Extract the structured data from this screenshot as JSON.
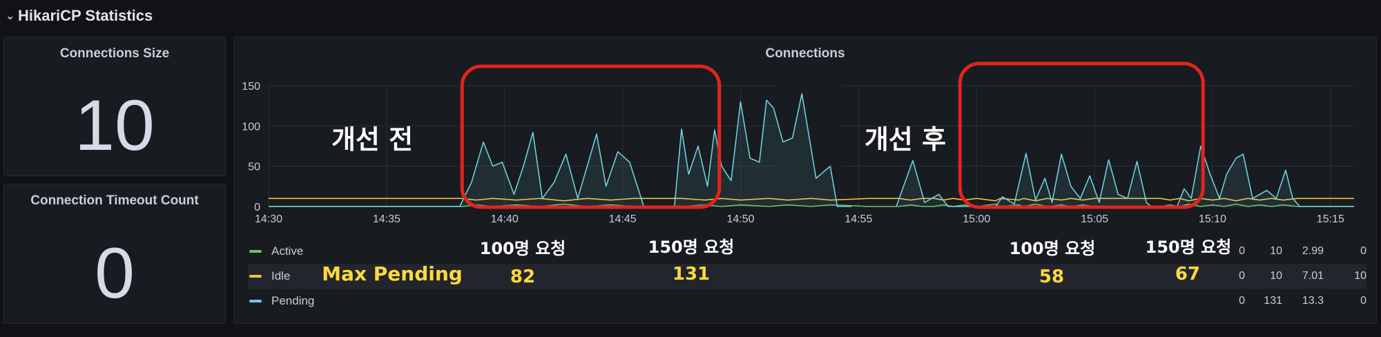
{
  "row": {
    "title": "HikariCP Statistics"
  },
  "panels": {
    "size": {
      "title": "Connections Size",
      "value": "10"
    },
    "timeout": {
      "title": "Connection Timeout Count",
      "value": "0"
    },
    "connections": {
      "title": "Connections"
    }
  },
  "chart_data": {
    "type": "line",
    "title": "Connections",
    "ylim": [
      0,
      150
    ],
    "y_ticks": [
      "0",
      "50",
      "100",
      "150"
    ],
    "x_tick_labels": [
      "14:30",
      "14:35",
      "14:40",
      "14:45",
      "14:50",
      "14:55",
      "15:00",
      "15:05",
      "15:10",
      "15:15"
    ],
    "x_domain_minutes": [
      0,
      46
    ],
    "grid": true,
    "legend_placement": "bottom",
    "series": [
      {
        "name": "Active",
        "color": "#73bf69",
        "x": [
          0,
          8.2,
          8.8,
          9.5,
          10.5,
          11.5,
          12.5,
          13.5,
          14.5,
          15,
          15.5,
          17.5,
          18.5,
          19.2,
          20,
          21.2,
          22,
          23,
          23.8,
          24.7,
          25.4,
          26.7,
          27.2,
          27.7,
          28.2,
          28.6,
          29,
          29.5,
          30,
          30.8,
          31,
          31.8,
          32,
          32.5,
          33,
          33.6,
          34,
          34.5,
          35,
          35.4,
          36,
          36.5,
          37,
          37.8,
          38.2,
          38.6,
          39,
          39.5,
          40,
          40.5,
          41,
          41.5,
          42,
          42.5,
          43,
          43.6,
          44.8,
          46
        ],
        "y": [
          0,
          0,
          2,
          0,
          2,
          0,
          3,
          0,
          2,
          1,
          0,
          0,
          2,
          0,
          2,
          0,
          2,
          0,
          2,
          1,
          0,
          0,
          2,
          0,
          0,
          2,
          0,
          2,
          0,
          3,
          0,
          2,
          0,
          3,
          0,
          2,
          0,
          2,
          0,
          0,
          0,
          0,
          0,
          0,
          2,
          0,
          3,
          0,
          2,
          0,
          3,
          0,
          2,
          0,
          2,
          0,
          0,
          0
        ]
      },
      {
        "name": "Idle",
        "color": "#f2c541",
        "x": [
          0,
          8.2,
          8.8,
          9.5,
          10.5,
          11.5,
          12.5,
          13.5,
          14.5,
          15,
          15.5,
          17.5,
          18.5,
          19.2,
          20,
          21.2,
          22,
          23,
          23.8,
          24.7,
          25.4,
          26.7,
          27.2,
          27.7,
          28.2,
          28.6,
          29,
          29.5,
          30,
          30.8,
          31,
          31.8,
          32,
          32.5,
          33,
          33.6,
          34,
          34.5,
          35,
          35.4,
          36,
          36.5,
          37,
          37.8,
          38.2,
          38.6,
          39,
          39.5,
          40,
          40.5,
          41,
          41.5,
          42,
          42.5,
          43,
          43.6,
          44.8,
          46
        ],
        "y": [
          10,
          10,
          8,
          10,
          8,
          10,
          7,
          10,
          8,
          9,
          10,
          10,
          8,
          10,
          8,
          10,
          8,
          10,
          8,
          9,
          10,
          10,
          8,
          10,
          10,
          8,
          10,
          8,
          10,
          7,
          10,
          8,
          10,
          7,
          10,
          8,
          10,
          8,
          10,
          10,
          10,
          10,
          10,
          10,
          8,
          10,
          7,
          10,
          8,
          10,
          7,
          10,
          8,
          10,
          8,
          10,
          10,
          10
        ]
      },
      {
        "name": "Pending",
        "color": "#6ed0e0",
        "x": [
          0,
          8.1,
          8.6,
          9.1,
          9.5,
          9.9,
          10.4,
          10.8,
          11.2,
          11.6,
          12.1,
          12.6,
          13.1,
          13.5,
          13.9,
          14.3,
          14.8,
          15.3,
          15.9,
          16,
          16.2,
          17.2,
          17.5,
          17.8,
          18.2,
          18.6,
          18.9,
          19.2,
          19.6,
          20,
          20.4,
          20.8,
          21.1,
          21.4,
          21.8,
          22.2,
          22.6,
          23.2,
          23.8,
          24.1,
          24.7,
          24.8,
          25.2,
          26.6,
          27.3,
          27.8,
          28.4,
          28.8,
          30.8,
          31.1,
          31.6,
          32.1,
          32.5,
          32.9,
          33.2,
          33.6,
          34,
          34.4,
          34.8,
          35.2,
          35.6,
          36,
          36.4,
          36.8,
          37.2,
          37.4,
          37.6,
          38.5,
          38.8,
          39.1,
          39.5,
          39.9,
          40.3,
          40.6,
          41,
          41.3,
          41.7,
          42,
          42.3,
          42.7,
          43.1,
          43.4,
          43.7,
          44.8,
          46
        ],
        "y": [
          0,
          0,
          30,
          80,
          50,
          55,
          15,
          50,
          92,
          10,
          30,
          65,
          10,
          50,
          90,
          25,
          68,
          55,
          0,
          null,
          null,
          0,
          96,
          40,
          75,
          25,
          95,
          50,
          32,
          130,
          60,
          55,
          132,
          122,
          80,
          85,
          140,
          35,
          50,
          0,
          0,
          null,
          null,
          0,
          57,
          5,
          15,
          0,
          0,
          12,
          3,
          66,
          8,
          35,
          5,
          65,
          25,
          10,
          38,
          5,
          58,
          15,
          10,
          56,
          5,
          0,
          0,
          0,
          22,
          10,
          75,
          40,
          10,
          40,
          60,
          65,
          10,
          15,
          20,
          10,
          45,
          10,
          0,
          0,
          0
        ]
      }
    ],
    "legend_stats": [
      {
        "name": "Active",
        "values": [
          "0",
          "10",
          "2.99",
          "0"
        ]
      },
      {
        "name": "Idle",
        "values": [
          "0",
          "10",
          "7.01",
          "10"
        ]
      },
      {
        "name": "Pending",
        "values": [
          "0",
          "131",
          "13.3",
          "0"
        ]
      }
    ],
    "annotations": {
      "before": "개선 전",
      "after": "개선 후",
      "max_pending": "Max Pending",
      "req100_before": "100명 요청",
      "req150_before": "150명 요청",
      "req100_after": "100명 요청",
      "req150_after": "150명 요청",
      "val_82": "82",
      "val_131": "131",
      "val_58": "58",
      "val_67": "67"
    },
    "highlight_color": "#e0241f"
  }
}
